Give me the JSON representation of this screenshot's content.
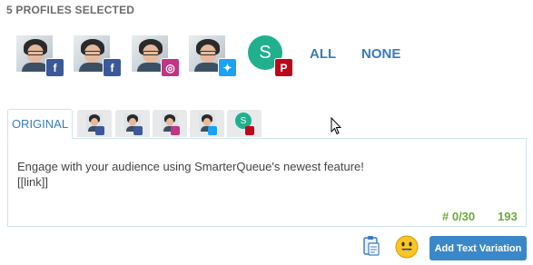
{
  "header": {
    "title": "5 PROFILES SELECTED"
  },
  "profiles": [
    {
      "network": "facebook",
      "badge_glyph": "f",
      "icon": "facebook-icon"
    },
    {
      "network": "facebook",
      "badge_glyph": "f",
      "icon": "facebook-icon"
    },
    {
      "network": "instagram",
      "badge_glyph": "◎",
      "icon": "instagram-icon"
    },
    {
      "network": "twitter",
      "badge_glyph": "✦",
      "icon": "twitter-icon"
    },
    {
      "network": "pinterest",
      "badge_glyph": "P",
      "avatar_letter": "S",
      "icon": "pinterest-icon"
    }
  ],
  "selection": {
    "all_label": "ALL",
    "none_label": "NONE"
  },
  "tabs": {
    "original_label": "ORIGINAL"
  },
  "editor": {
    "text": "Engage with your audience using SmarterQueue's newest feature!\n[[link]]",
    "hashtag_count": "# 0/30",
    "char_count": "193"
  },
  "actions": {
    "add_text_variation_label": "Add Text Variation"
  },
  "colors": {
    "accent": "#3a7bbf",
    "button": "#3a88c8",
    "count_green": "#6aaa3a",
    "facebook": "#3b5998",
    "instagram": "#c13584",
    "twitter": "#1da1f2",
    "pinterest": "#bd081c",
    "avatar_green": "#20b08d"
  }
}
